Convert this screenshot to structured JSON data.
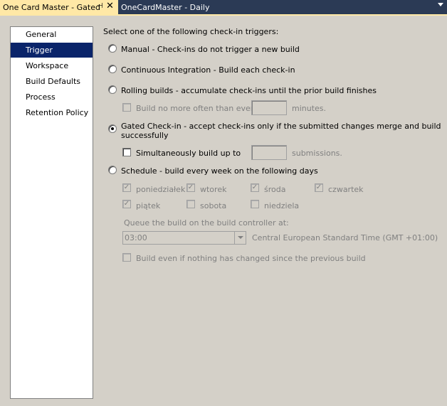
{
  "tabs": {
    "active": "One Card Master - Gated",
    "inactive": "OneCardMaster - Daily"
  },
  "nav": {
    "items": [
      {
        "label": "General"
      },
      {
        "label": "Trigger",
        "selected": true
      },
      {
        "label": "Workspace"
      },
      {
        "label": "Build Defaults"
      },
      {
        "label": "Process"
      },
      {
        "label": "Retention Policy"
      }
    ]
  },
  "trigger": {
    "heading": "Select one of the following check-in triggers:",
    "manual": "Manual - Check-ins do not trigger a new build",
    "ci": "Continuous Integration - Build each check-in",
    "rolling": "Rolling builds - accumulate check-ins until the prior build finishes",
    "rolling_option_label": "Build no more often than every",
    "rolling_option_value": "",
    "rolling_option_unit": "minutes.",
    "gated_line1": "Gated Check-in - accept check-ins only if the submitted changes merge and build",
    "gated_line2": "successfully",
    "gated_option_label": "Simultaneously build up to",
    "gated_option_value": "",
    "gated_option_unit": "submissions.",
    "schedule": "Schedule - build every week on the following days",
    "days": {
      "mon": "poniedziałek",
      "tue": "wtorek",
      "wed": "środa",
      "thu": "czwartek",
      "fri": "piątek",
      "sat": "sobota",
      "sun": "niedziela"
    },
    "queue_label": "Queue the build on the build controller at:",
    "queue_time": "03:00",
    "timezone": "Central European Standard Time (GMT +01:00)",
    "build_even": "Build even if nothing has changed since the previous build",
    "selected": "gated"
  }
}
